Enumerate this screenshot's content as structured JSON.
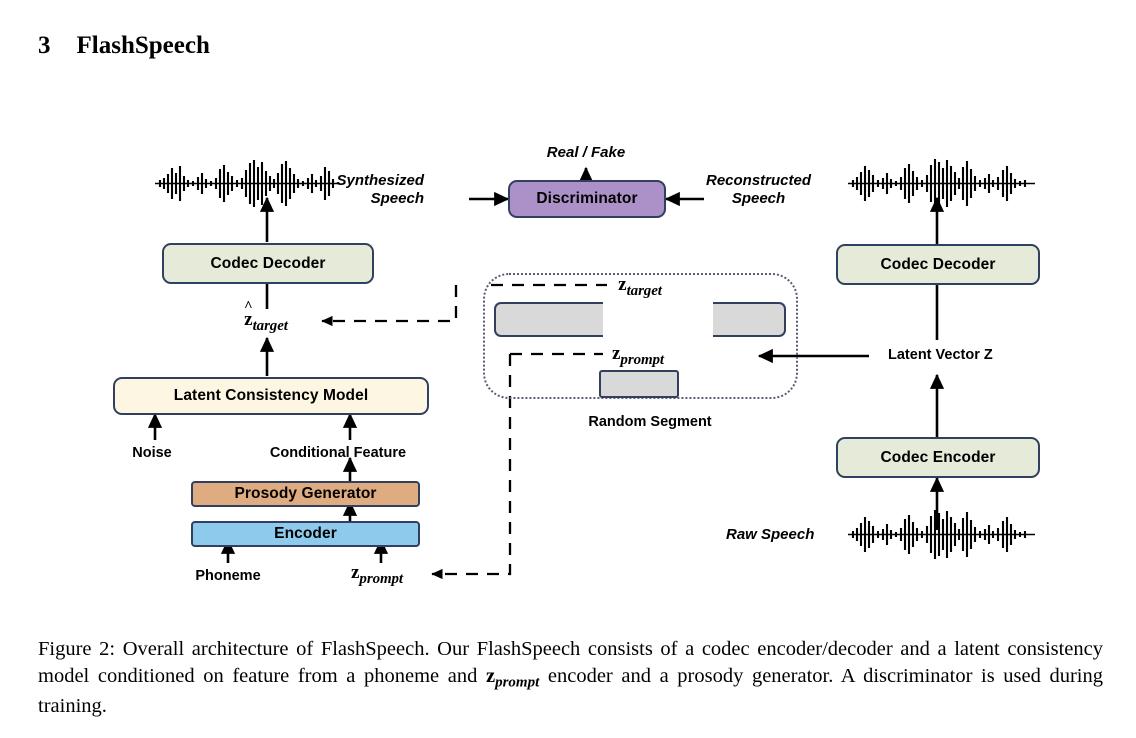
{
  "section": {
    "number": "3",
    "title": "FlashSpeech"
  },
  "figure": {
    "nodes": [
      {
        "id": "codec-decoder-left",
        "label": "Codec Decoder",
        "color": "#e6ebd9"
      },
      {
        "id": "latent-consistency",
        "label": "Latent Consistency Model",
        "color": "#fcf6e2"
      },
      {
        "id": "prosody-generator",
        "label": "Prosody Generator",
        "color": "#dfac81"
      },
      {
        "id": "encoder",
        "label": "Encoder",
        "color": "#8ecaeb"
      },
      {
        "id": "discriminator",
        "label": "Discriminator",
        "color": "#ab91c7"
      },
      {
        "id": "codec-decoder-right",
        "label": "Codec Decoder",
        "color": "#e6ebd9"
      },
      {
        "id": "codec-encoder",
        "label": "Codec Encoder",
        "color": "#e6ebd9"
      }
    ],
    "labels": {
      "real_fake": "Real / Fake",
      "synthesized_speech": "Synthesized\nSpeech",
      "synthesized_speech_l1": "Synthesized",
      "synthesized_speech_l2": "Speech",
      "reconstructed_speech_l1": "Reconstructed",
      "reconstructed_speech_l2": "Speech",
      "noise": "Noise",
      "conditional_feature": "Conditional Feature",
      "phoneme": "Phoneme",
      "random_segment": "Random Segment",
      "latent_vector_z": "Latent Vector Z",
      "raw_speech": "Raw Speech"
    },
    "math_labels": {
      "z_target_hat_base": "z",
      "z_target_hat_sub": "target",
      "z_target_base": "z",
      "z_target_sub": "target",
      "z_prompt_base": "z",
      "z_prompt_sub": "prompt",
      "z_prompt_bottom_base": "z",
      "z_prompt_bottom_sub": "prompt",
      "hat_glyph": "^"
    },
    "colors": {
      "box_border": "#31405e",
      "codec_green": "#e6ebd9",
      "latent_cream": "#fcf6e2",
      "prosody_tan": "#dfac81",
      "encoder_blue": "#8ecaeb",
      "discriminator_purple": "#ab91c7",
      "segment_gray": "#d9d9d9",
      "dotted_border": "#5b5b76",
      "arrow_black": "#000000"
    }
  },
  "caption": {
    "prefix": "Figure 2: ",
    "text_part1": "Overall architecture of FlashSpeech. Our FlashSpeech consists of a codec encoder/decoder and a latent consistency model conditioned on feature from a phoneme and ",
    "z_base": "z",
    "z_sub": "prompt",
    "text_part2": " encoder and a prosody generator. A discriminator is used during training."
  }
}
